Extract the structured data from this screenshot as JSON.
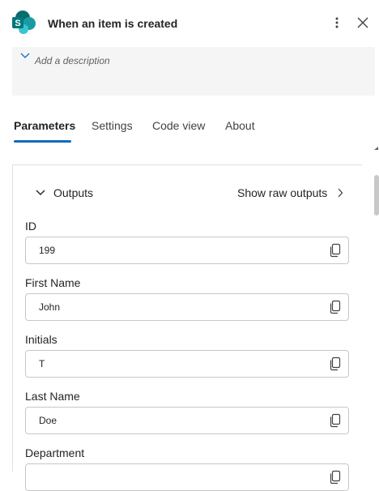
{
  "header": {
    "title": "When an item is created",
    "app_icon": "sharepoint-icon",
    "more_icon": "more-vertical-icon",
    "close_icon": "close-icon",
    "brand_colors": [
      "#036c70",
      "#1a9ba1",
      "#37c6d0"
    ]
  },
  "description": {
    "placeholder": "Add a description",
    "chevron_icon": "chevron-down-icon"
  },
  "tabs": {
    "items": [
      {
        "label": "Parameters",
        "active": true
      },
      {
        "label": "Settings",
        "active": false
      },
      {
        "label": "Code view",
        "active": false
      },
      {
        "label": "About",
        "active": false
      }
    ],
    "accent_color": "#0f6cbd"
  },
  "outputs": {
    "toggle_label": "Outputs",
    "raw_outputs_label": "Show raw outputs",
    "fields": [
      {
        "label": "ID",
        "value": "199"
      },
      {
        "label": "First Name",
        "value": "John"
      },
      {
        "label": "Initials",
        "value": "T"
      },
      {
        "label": "Last Name",
        "value": "Doe"
      },
      {
        "label": "Department",
        "value": ""
      }
    ]
  }
}
